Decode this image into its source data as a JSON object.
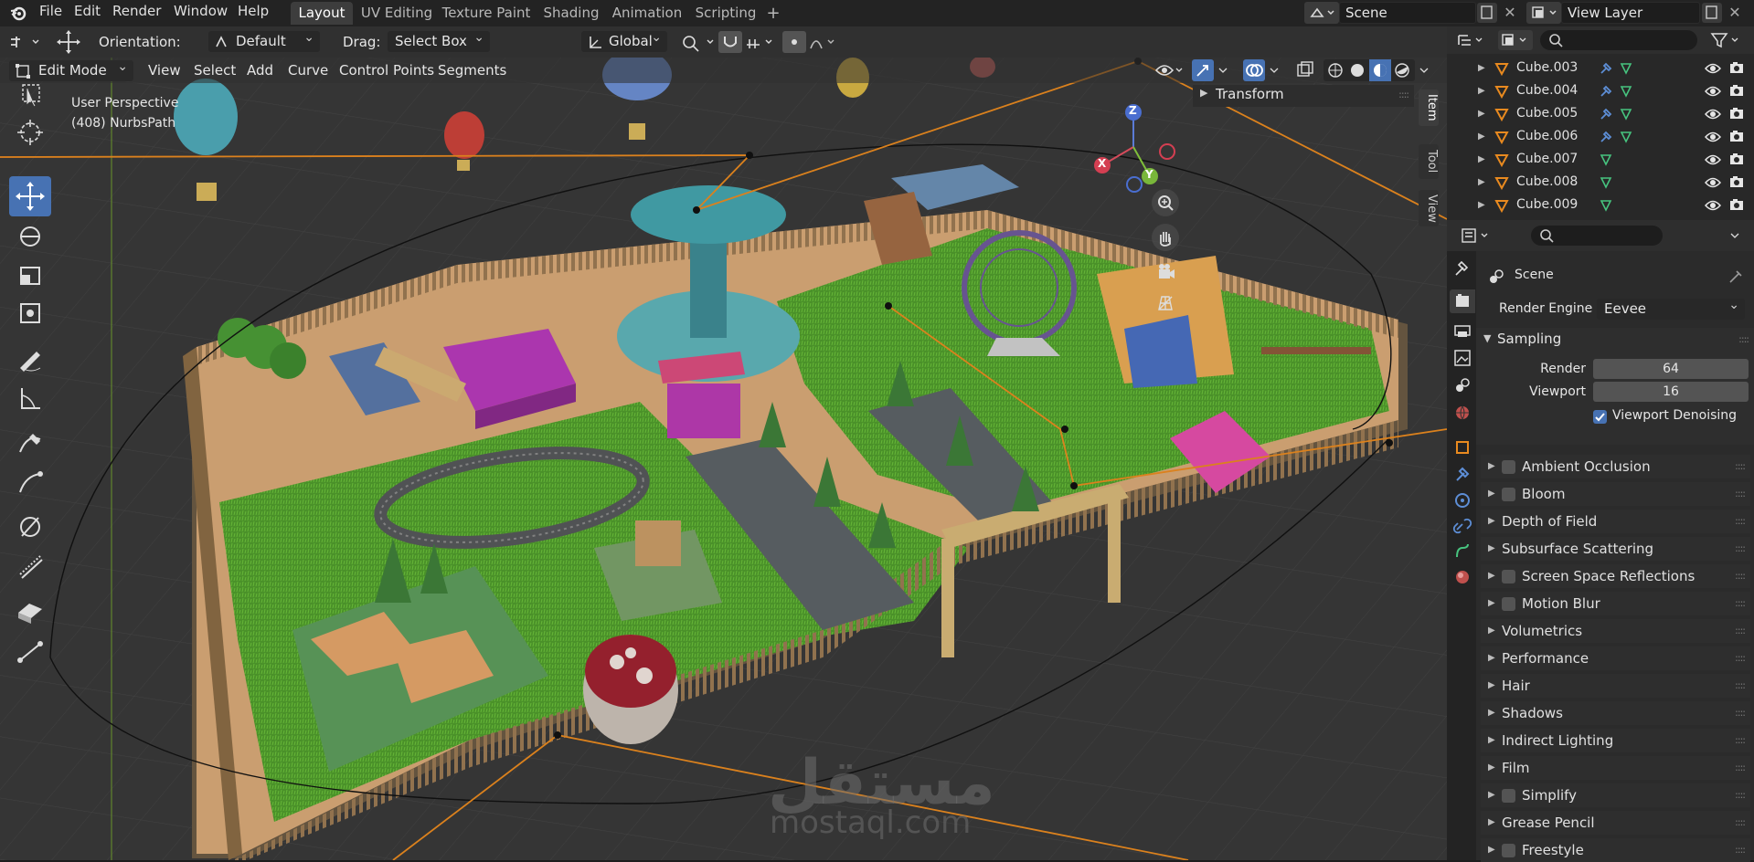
{
  "topbar": {
    "menus": [
      "File",
      "Edit",
      "Render",
      "Window",
      "Help"
    ],
    "workspaces": [
      "Layout",
      "UV Editing",
      "Texture Paint",
      "Shading",
      "Animation",
      "Scripting"
    ],
    "add_workspace": "+",
    "scene_name": "Scene",
    "view_layer": "View Layer"
  },
  "viewport_header": {
    "orientation_label": "Orientation:",
    "orientation_value": "Default",
    "drag_label": "Drag:",
    "drag_value": "Select Box",
    "transform_space": "Global"
  },
  "viewport_header2": {
    "mode": "Edit Mode",
    "menus": [
      "View",
      "Select",
      "Add",
      "Curve",
      "Control Points",
      "Segments"
    ]
  },
  "viewport": {
    "perspective": "User Perspective",
    "object_info": "(408) NurbsPath",
    "transform_panel": "Transform",
    "side_tabs": [
      "Item",
      "Tool",
      "View"
    ],
    "gizmo_axes": [
      "X",
      "Y",
      "Z"
    ],
    "watermark_arabic": "مستقل",
    "watermark_latin": "mostaql.com"
  },
  "outliner": {
    "items": [
      "Cube.003",
      "Cube.004",
      "Cube.005",
      "Cube.006",
      "Cube.007",
      "Cube.008",
      "Cube.009"
    ]
  },
  "properties": {
    "context": "Scene",
    "render_engine_label": "Render Engine",
    "render_engine_value": "Eevee",
    "sampling": {
      "title": "Sampling",
      "render_label": "Render",
      "render_value": "64",
      "viewport_label": "Viewport",
      "viewport_value": "16",
      "denoise_label": "Viewport Denoising",
      "denoise_checked": true
    },
    "sections": [
      {
        "label": "Ambient Occlusion",
        "checkbox": true
      },
      {
        "label": "Bloom",
        "checkbox": true
      },
      {
        "label": "Depth of Field",
        "checkbox": false
      },
      {
        "label": "Subsurface Scattering",
        "checkbox": false
      },
      {
        "label": "Screen Space Reflections",
        "checkbox": true
      },
      {
        "label": "Motion Blur",
        "checkbox": true
      },
      {
        "label": "Volumetrics",
        "checkbox": false
      },
      {
        "label": "Performance",
        "checkbox": false
      },
      {
        "label": "Hair",
        "checkbox": false
      },
      {
        "label": "Shadows",
        "checkbox": false
      },
      {
        "label": "Indirect Lighting",
        "checkbox": false
      },
      {
        "label": "Film",
        "checkbox": false
      },
      {
        "label": "Simplify",
        "checkbox": true
      },
      {
        "label": "Grease Pencil",
        "checkbox": false
      },
      {
        "label": "Freestyle",
        "checkbox": true
      }
    ]
  },
  "colors": {
    "accent_blue": "#4772b3",
    "grass": "#55a530",
    "ground": "#d7a877",
    "curve_orange": "#e98a1f"
  }
}
